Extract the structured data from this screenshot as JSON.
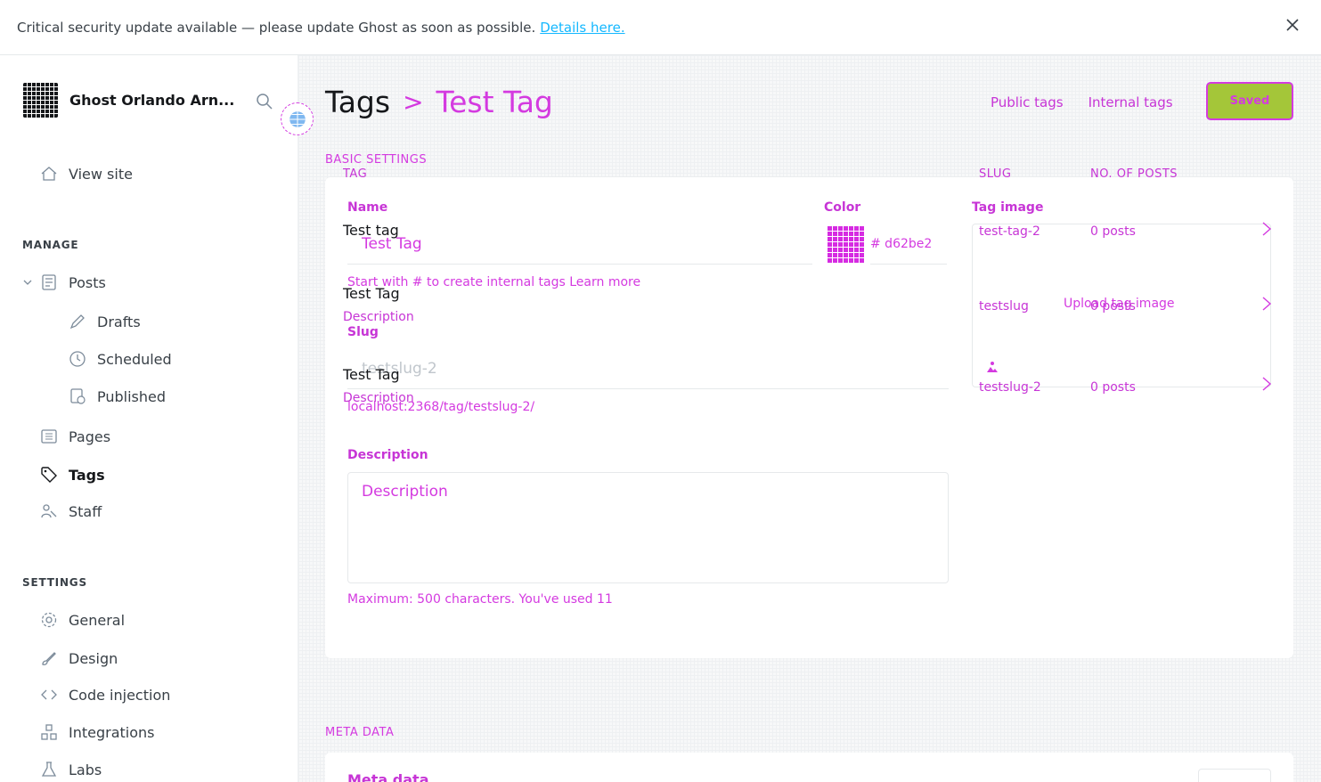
{
  "alert": {
    "text": "Critical security update available — please update Ghost as soon as possible.",
    "link": "Details here."
  },
  "sidebar": {
    "site_name": "Ghost Orlando Arn...",
    "view_site": "View site",
    "manage_heading": "MANAGE",
    "posts": "Posts",
    "drafts": "Drafts",
    "scheduled": "Scheduled",
    "published": "Published",
    "pages": "Pages",
    "tags": "Tags",
    "staff": "Staff",
    "settings_heading": "SETTINGS",
    "general": "General",
    "design": "Design",
    "code_injection": "Code injection",
    "integrations": "Integrations",
    "labs": "Labs"
  },
  "header": {
    "breadcrumb_parent": "Tags",
    "breadcrumb_sep": ">",
    "breadcrumb_current": "Test Tag",
    "public_tags": "Public tags",
    "internal_tags": "Internal tags",
    "save": "Saved"
  },
  "basic": {
    "section_label": "BASIC SETTINGS",
    "name_label": "Name",
    "name_value": "Test Tag",
    "name_hint": "Start with # to create internal tags Learn more",
    "color_label": "Color",
    "color_value": "# d62be2",
    "slug_label": "Slug",
    "slug_value": "testslug-2",
    "slug_url": "localhost:2368/tag/testslug-2/",
    "description_label": "Description",
    "description_placeholder": "Description",
    "description_hint": "Maximum: 500 characters. You've used 11",
    "image_label": "Tag image",
    "upload_label": "Upload tag image"
  },
  "overlay_list": {
    "col_tag": "TAG",
    "col_slug": "SLUG",
    "col_posts": "NO. OF POSTS",
    "rows": [
      {
        "name": "Test tag",
        "desc": "",
        "slug": "test-tag-2",
        "posts": "0 posts"
      },
      {
        "name": "Test Tag",
        "desc": "Description",
        "slug": "testslug",
        "posts": "0 posts"
      },
      {
        "name": "Test Tag",
        "desc": "Description",
        "slug": "testslug-2",
        "posts": "0 posts"
      }
    ]
  },
  "meta": {
    "section_label": "META DATA",
    "title": "Meta data"
  }
}
